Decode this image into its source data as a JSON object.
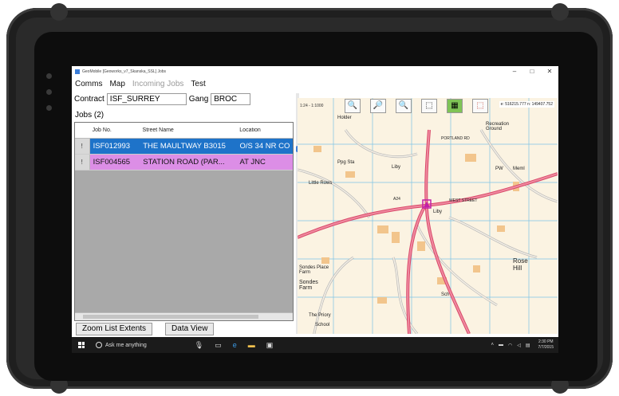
{
  "window": {
    "title": "GeoMobile [Geoworks_v7_Skanska_SSL] Jobs",
    "controls": [
      "–",
      "□",
      "✕"
    ]
  },
  "menu": {
    "items": [
      "Comms",
      "Map"
    ],
    "disabled_item": "Incoming Jobs",
    "test": "Test"
  },
  "filters": {
    "contract_label": "Contract",
    "contract_value": "ISF_SURREY",
    "gang_label": "Gang",
    "gang_value": "BROC"
  },
  "jobs": {
    "label": "Jobs (2)",
    "columns": [
      "Job No.",
      "Street Name",
      "Location"
    ],
    "rows": [
      {
        "flag": "!",
        "job_no": "ISF012993",
        "street": "THE MAULTWAY B3015",
        "location": "O/S 34 NR CO",
        "color": "#1e73c9"
      },
      {
        "flag": "!",
        "job_no": "ISF004565",
        "street": "STATION ROAD (PAR...",
        "location": "AT JNC",
        "color": "#dc8ee6"
      }
    ]
  },
  "buttons": {
    "zoom": "Zoom List Extents",
    "data_view": "Data View"
  },
  "map": {
    "scale": "1:24 - 1:1000",
    "coords": "e: 516215.777 n: 149407.752",
    "tools": [
      "zoom-in-icon",
      "zoom-area-icon",
      "zoom-out-icon",
      "select-icon",
      "layers-icon",
      "clear-icon"
    ],
    "labels": {
      "holder": "Holder",
      "recreation": "Recreation Ground",
      "portland": "PORTLAND RD",
      "ppg": "Ppg Sta",
      "liby": "Liby",
      "little_rows": "Little Rows",
      "west_st": "WEST STREET",
      "sondes": "Sondes Farm",
      "sondes_place": "Sondes Place Farm",
      "rose_hill": "Rose Hill",
      "priory": "The Priory",
      "school": "School",
      "pw": "PW",
      "sch": "Sch",
      "a24": "A24",
      "mem": "Meml"
    },
    "colors": {
      "road_major": "#d94a6a",
      "road_minor": "#f3eee4",
      "building": "#f2c58c",
      "grid": "#7cc3e6"
    }
  },
  "taskbar": {
    "search": "Ask me anything",
    "time": "2:30 PM",
    "date": "7/7/2015"
  }
}
